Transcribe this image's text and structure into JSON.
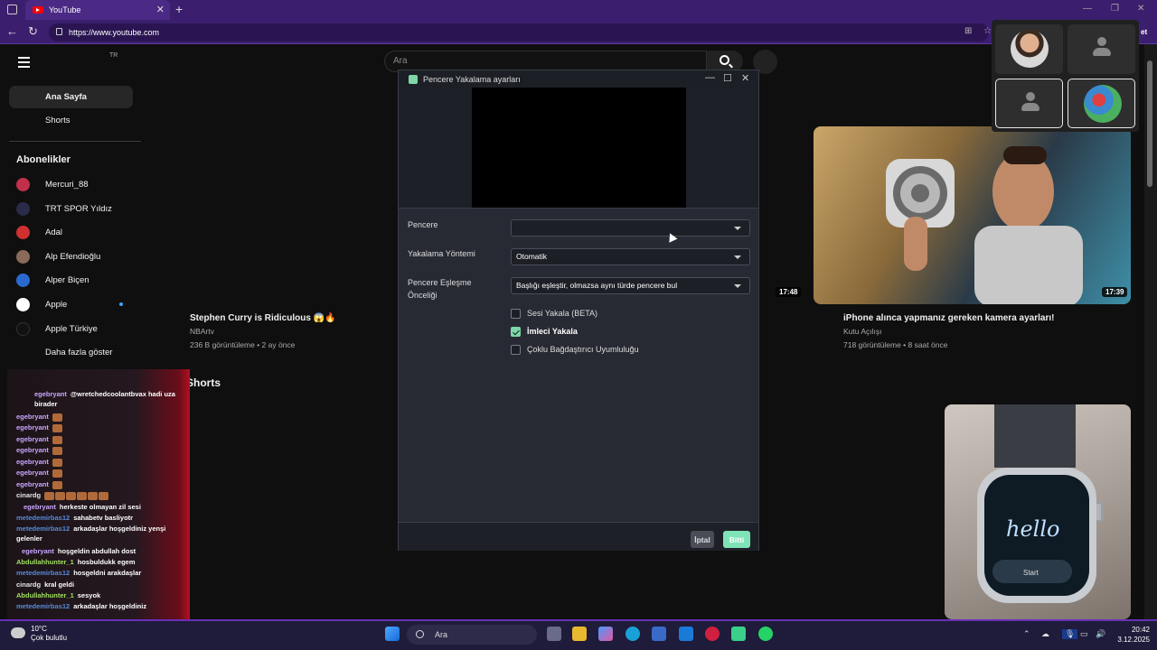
{
  "browser": {
    "tab_title": "YouTube",
    "url": "https://www.youtube.com",
    "partial_button": "et"
  },
  "youtube": {
    "country": "TR",
    "search_placeholder": "Ara",
    "sidebar": {
      "items": [
        {
          "label": "Ana Sayfa",
          "active": true
        },
        {
          "label": "Shorts",
          "active": false
        }
      ],
      "subscriptions_title": "Abonelikler",
      "subscriptions": [
        {
          "label": "Mercuri_88",
          "color": "#c0304a"
        },
        {
          "label": "TRT SPOR Yıldız",
          "color": "#2a2a4a"
        },
        {
          "label": "Adal",
          "color": "#d03030"
        },
        {
          "label": "Alp Efendioğlu",
          "color": "#8a6a5a"
        },
        {
          "label": "Alper Biçen",
          "color": "#2a6ad0"
        },
        {
          "label": "Apple",
          "color": "#ffffff",
          "new": true
        },
        {
          "label": "Apple Türkiye",
          "color": "#111111"
        },
        {
          "label": "Daha fazla göster",
          "color": ""
        }
      ]
    },
    "videos": [
      {
        "title": "Stephen Curry is Ridiculous 😱🔥",
        "channel": "NBArtv",
        "meta": "236 B görüntüleme • 2 ay önce",
        "duration": "17:48"
      },
      {
        "title": "iPhone alınca yapmanız gereken kamera ayarları!",
        "channel": "Kutu Açılışı",
        "meta": "718 görüntüleme • 8 saat önce",
        "duration": "17:39"
      }
    ],
    "shorts_title": "Shorts",
    "watch_text": "hello",
    "watch_button": "Start"
  },
  "chat": [
    {
      "user": "egebryant",
      "color": "#c9a6ff",
      "msg": "@wretchedcoolantbvax hadi uza birader",
      "emotes": 0
    },
    {
      "user": "egebryant",
      "color": "#c9a6ff",
      "msg": "",
      "emotes": 1
    },
    {
      "user": "egebryant",
      "color": "#c9a6ff",
      "msg": "",
      "emotes": 1
    },
    {
      "user": "egebryant",
      "color": "#c9a6ff",
      "msg": "",
      "emotes": 1
    },
    {
      "user": "egebryant",
      "color": "#c9a6ff",
      "msg": "",
      "emotes": 1
    },
    {
      "user": "egebryant",
      "color": "#c9a6ff",
      "msg": "",
      "emotes": 1
    },
    {
      "user": "egebryant",
      "color": "#c9a6ff",
      "msg": "",
      "emotes": 1
    },
    {
      "user": "egebryant",
      "color": "#c9a6ff",
      "msg": "",
      "emotes": 1
    },
    {
      "user": "cinardg",
      "color": "#e6e6e6",
      "msg": "",
      "emotes": 6
    },
    {
      "user": "egebryant",
      "color": "#c9a6ff",
      "msg": "herkeste olmayan zil sesi",
      "emotes": 0
    },
    {
      "user": "metedemirbas12",
      "color": "#5a8ad8",
      "msg": "sahabetv basliyotr",
      "emotes": 0
    },
    {
      "user": "metedemirbas12",
      "color": "#5a8ad8",
      "msg": "arkadaşlar hoşgeldiniz yenşi gelenler",
      "emotes": 0
    },
    {
      "user": "egebryant",
      "color": "#c9a6ff",
      "msg": "hoşgeldin abdullah dost",
      "emotes": 0
    },
    {
      "user": "Abdullahhunter_1",
      "color": "#a0e060",
      "msg": "hosbuldukk egem",
      "emotes": 0
    },
    {
      "user": "metedemirbas12",
      "color": "#5a8ad8",
      "msg": "hosgeldni arakdaşlar",
      "emotes": 0
    },
    {
      "user": "cinardg",
      "color": "#e6e6e6",
      "msg": "kral geldi",
      "emotes": 0
    },
    {
      "user": "Abdullahhunter_1",
      "color": "#a0e060",
      "msg": "sesyok",
      "emotes": 0
    },
    {
      "user": "metedemirbas12",
      "color": "#5a8ad8",
      "msg": "arkadaşlar hoşgeldiniz",
      "emotes": 0
    }
  ],
  "dialog": {
    "title": "Pencere Yakalama ayarları",
    "window_label": "Pencere",
    "window_value": "",
    "method_label": "Yakalama Yöntemi",
    "method_value": "Otomatik",
    "match_label_1": "Pencere Eşleşme",
    "match_label_2": "Önceliği",
    "match_value": "Başlığı eşleştir, olmazsa aynı türde pencere bul",
    "checkboxes": [
      {
        "label": "Sesi Yakala (BETA)",
        "checked": false
      },
      {
        "label": "İmleci Yakala",
        "checked": true
      },
      {
        "label": "Çoklu Bağdaştırıcı Uyumluluğu",
        "checked": false
      }
    ],
    "cancel_label": "İptal",
    "done_label": "Bitti"
  },
  "taskbar": {
    "temperature": "10°C",
    "weather": "Çok bulutlu",
    "search": "Ara",
    "time": "20:42",
    "date": "3.12.2025"
  }
}
